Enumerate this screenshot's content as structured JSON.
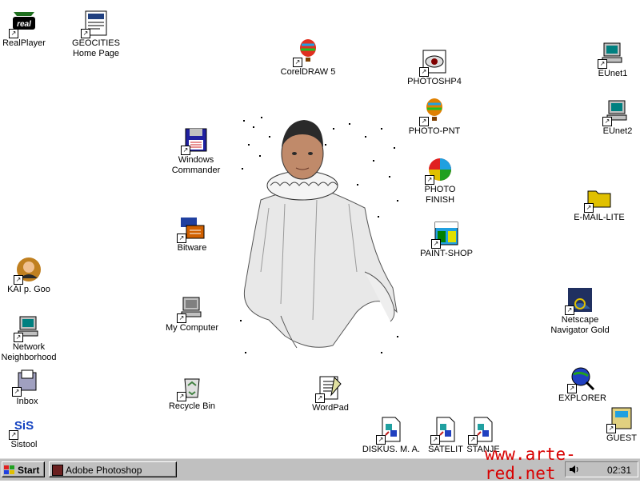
{
  "desktop": {
    "icons": [
      {
        "label": "RealPlayer",
        "icon": "realplayer-icon",
        "color": "#1e6e1e"
      },
      {
        "label": "GEOCITIES\nHome Page",
        "icon": "webpage-icon",
        "color": "#204080"
      },
      {
        "label": "CorelDRAW 5",
        "icon": "balloon-icon",
        "color": "#e03020"
      },
      {
        "label": "PHOTOSHP4",
        "icon": "eye-icon",
        "color": "#800000"
      },
      {
        "label": "EUnet1",
        "icon": "network-computer-icon",
        "color": "#008080"
      },
      {
        "label": "PHOTO-PNT",
        "icon": "balloon-camera-icon",
        "color": "#e08000"
      },
      {
        "label": "EUnet2",
        "icon": "network-computer-icon",
        "color": "#008080"
      },
      {
        "label": "Windows\nCommander",
        "icon": "floppy-disk-icon",
        "color": "#2020a0"
      },
      {
        "label": "PHOTO\nFINISH",
        "icon": "color-wheel-icon",
        "color": "#20a020"
      },
      {
        "label": "E-MAIL-LITE",
        "icon": "folder-icon",
        "color": "#e0c000"
      },
      {
        "label": "Bitware",
        "icon": "bitware-icon",
        "color": "#d06000"
      },
      {
        "label": "PAINT-SHOP",
        "icon": "paint-shop-icon",
        "color": "#008000"
      },
      {
        "label": "KAI p. Goo",
        "icon": "portrait-icon",
        "color": "#c08020"
      },
      {
        "label": "My Computer",
        "icon": "computer-icon",
        "color": "#808080"
      },
      {
        "label": "Netscape\nNavigator Gold",
        "icon": "netscape-icon",
        "color": "#203060"
      },
      {
        "label": "Network\nNeighborhood",
        "icon": "network-icon",
        "color": "#008080"
      },
      {
        "label": "Inbox",
        "icon": "inbox-icon",
        "color": "#404080"
      },
      {
        "label": "Recycle Bin",
        "icon": "recycle-bin-icon",
        "color": "#408040"
      },
      {
        "label": "EXPLORER",
        "icon": "explorer-icon",
        "color": "#2040c0"
      },
      {
        "label": "WordPad",
        "icon": "wordpad-icon",
        "color": "#e0e0a0"
      },
      {
        "label": "Sistool",
        "icon": "sis-icon",
        "color": "#1040c0"
      },
      {
        "label": "DISKUS. M. A.",
        "icon": "document-icon",
        "color": "#20a0a0"
      },
      {
        "label": "SATELIT",
        "icon": "document-icon",
        "color": "#20a0a0"
      },
      {
        "label": "STANJE",
        "icon": "document-icon",
        "color": "#20a0a0"
      },
      {
        "label": "GUEST",
        "icon": "guest-icon",
        "color": "#e0d080"
      }
    ]
  },
  "taskbar": {
    "start_label": "Start",
    "task_label": "Adobe Photoshop",
    "clock": "02:31"
  },
  "watermark": "www.arte-red.net"
}
